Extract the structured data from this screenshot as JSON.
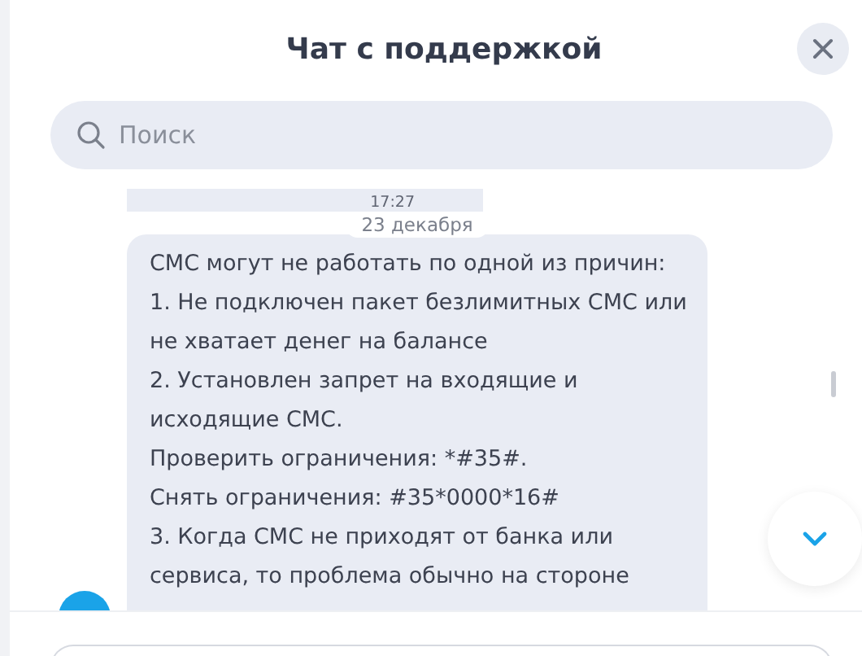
{
  "header": {
    "title": "Чат с поддержкой"
  },
  "search": {
    "placeholder": "Поиск"
  },
  "messages": [
    {
      "kind": "previous",
      "time": "17:27"
    },
    {
      "kind": "date",
      "label": "23 декабря"
    },
    {
      "kind": "bubble",
      "lines": [
        "СМС могут не работать по одной из причин:",
        "1. Не подключен пакет безлимитных СМС или",
        "не хватает денег на балансе",
        "2. Установлен запрет на входящие и",
        "исходящие СМС.",
        "Проверить ограничения: *#35#.",
        "Снять ограничения: #35*0000*16#",
        "3. Когда СМС не приходят от банка или",
        "сервиса, то проблема обычно на стороне"
      ]
    }
  ]
}
